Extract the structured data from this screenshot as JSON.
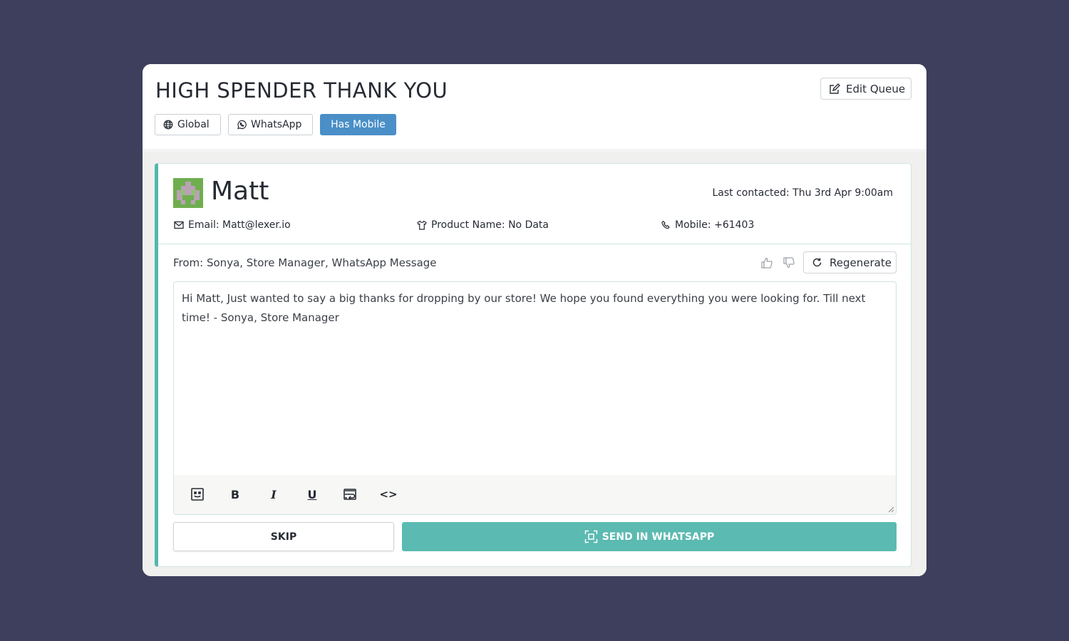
{
  "queue": {
    "title": "HIGH SPENDER THANK YOU",
    "edit_button_label": "Edit Queue",
    "tags": [
      {
        "label": "Global",
        "icon": "globe-icon",
        "active": false
      },
      {
        "label": "WhatsApp",
        "icon": "whatsapp-icon",
        "active": false
      },
      {
        "label": "Has Mobile",
        "icon": "",
        "active": true
      }
    ]
  },
  "contact": {
    "name": "Matt",
    "avatar_icon": "pixel-avatar-icon",
    "last_contacted": "Last contacted: Thu 3rd Apr 9:00am",
    "email": "Email: Matt@lexer.io",
    "product_name": "Product Name: No Data",
    "mobile": "Mobile: +61403"
  },
  "message": {
    "from": "From: Sonya, Store Manager, WhatsApp Message",
    "regenerate_label": "Regenerate",
    "body": "Hi Matt, Just wanted to say a big thanks for dropping by our store! We hope you found everything you were looking for. Till next time! - Sonya, Store Manager"
  },
  "toolbar": {
    "bold": "B",
    "italic": "I",
    "underline": "U",
    "code": "<>"
  },
  "actions": {
    "skip_label": "SKIP",
    "send_label": "SEND IN WHATSAPP"
  },
  "colors": {
    "background": "#3d3f5c",
    "accent_teal": "#5bbab1",
    "tag_active": "#4a8fc7",
    "avatar_green": "#6fae4f"
  }
}
